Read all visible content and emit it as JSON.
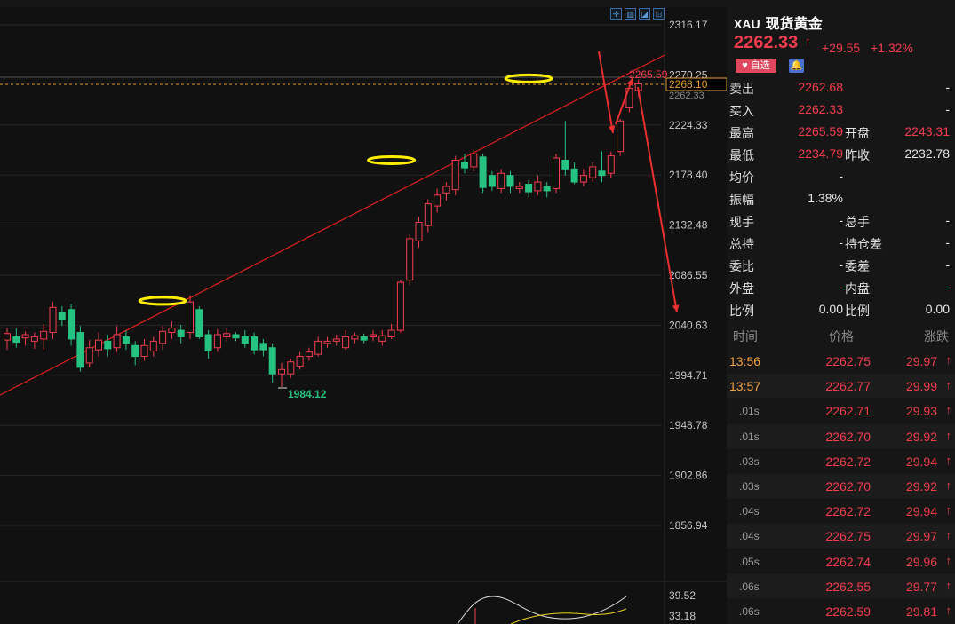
{
  "toolbar": {
    "icons": [
      "crosshair-icon",
      "candle-icon",
      "line-icon",
      "expand-icon"
    ]
  },
  "chart": {
    "price_ticks": [
      "2316.17",
      "2270.25",
      "2224.33",
      "2178.40",
      "2132.48",
      "2086.55",
      "2040.63",
      "1994.71",
      "1948.78",
      "1902.86",
      "1856.94"
    ],
    "indicator_ticks": [
      "39.52",
      "33.18"
    ],
    "high_label": "2265.59",
    "low_label": "1984.12",
    "cursor_price": "2268.10",
    "cursor_price_sub": "2262.33",
    "colors": {
      "up": "#f23d4f",
      "down": "#26c281",
      "trend_line": "#e0201e",
      "highlight": "#ffee00"
    }
  },
  "chart_data": {
    "type": "candlestick",
    "ylim": [
      1840,
      2330
    ],
    "candles": [
      [
        2027,
        2033,
        2018,
        2038
      ],
      [
        2030,
        2025,
        2020,
        2038
      ],
      [
        2029,
        2032,
        2022,
        2035
      ],
      [
        2026,
        2030,
        2019,
        2034
      ],
      [
        2028,
        2035,
        2018,
        2042
      ],
      [
        2034,
        2057,
        2028,
        2062
      ],
      [
        2052,
        2046,
        2040,
        2058
      ],
      [
        2055,
        2028,
        2022,
        2060
      ],
      [
        2034,
        2002,
        1998,
        2040
      ],
      [
        2006,
        2020,
        2002,
        2027
      ],
      [
        2018,
        2027,
        2012,
        2034
      ],
      [
        2026,
        2019,
        2012,
        2032
      ],
      [
        2020,
        2032,
        2016,
        2040
      ],
      [
        2030,
        2024,
        2018,
        2036
      ],
      [
        2022,
        2012,
        2004,
        2026
      ],
      [
        2012,
        2022,
        2008,
        2028
      ],
      [
        2017,
        2026,
        2012,
        2030
      ],
      [
        2024,
        2035,
        2018,
        2040
      ],
      [
        2034,
        2038,
        2028,
        2044
      ],
      [
        2036,
        2030,
        2024,
        2041
      ],
      [
        2034,
        2062,
        2028,
        2068
      ],
      [
        2055,
        2030,
        2028,
        2058
      ],
      [
        2032,
        2017,
        2010,
        2036
      ],
      [
        2020,
        2032,
        2016,
        2037
      ],
      [
        2030,
        2033,
        2026,
        2038
      ],
      [
        2032,
        2029,
        2026,
        2034
      ],
      [
        2030,
        2024,
        2020,
        2036
      ],
      [
        2030,
        2018,
        2014,
        2034
      ],
      [
        2024,
        2018,
        2012,
        2028
      ],
      [
        2020,
        1996,
        1988,
        2024
      ],
      [
        1996,
        2000,
        1984,
        2006
      ],
      [
        1996,
        2007,
        1992,
        2010
      ],
      [
        2003,
        2012,
        2000,
        2016
      ],
      [
        2012,
        2016,
        2008,
        2020
      ],
      [
        2014,
        2026,
        2012,
        2030
      ],
      [
        2024,
        2026,
        2020,
        2030
      ],
      [
        2026,
        2028,
        2022,
        2032
      ],
      [
        2020,
        2030,
        2018,
        2036
      ],
      [
        2028,
        2031,
        2024,
        2034
      ],
      [
        2030,
        2027,
        2024,
        2033
      ],
      [
        2030,
        2032,
        2026,
        2036
      ],
      [
        2026,
        2031,
        2022,
        2036
      ],
      [
        2030,
        2036,
        2028,
        2042
      ],
      [
        2036,
        2080,
        2034,
        2082
      ],
      [
        2082,
        2120,
        2078,
        2124
      ],
      [
        2118,
        2135,
        2112,
        2140
      ],
      [
        2132,
        2152,
        2126,
        2156
      ],
      [
        2150,
        2160,
        2144,
        2166
      ],
      [
        2162,
        2168,
        2155,
        2172
      ],
      [
        2165,
        2192,
        2160,
        2196
      ],
      [
        2190,
        2185,
        2180,
        2198
      ],
      [
        2186,
        2198,
        2182,
        2202
      ],
      [
        2195,
        2167,
        2162,
        2198
      ],
      [
        2178,
        2168,
        2164,
        2182
      ],
      [
        2166,
        2180,
        2162,
        2184
      ],
      [
        2178,
        2168,
        2162,
        2182
      ],
      [
        2166,
        2168,
        2162,
        2172
      ],
      [
        2170,
        2163,
        2158,
        2174
      ],
      [
        2164,
        2172,
        2160,
        2178
      ],
      [
        2168,
        2164,
        2158,
        2172
      ],
      [
        2166,
        2194,
        2162,
        2198
      ],
      [
        2192,
        2184,
        2178,
        2228
      ],
      [
        2184,
        2172,
        2170,
        2190
      ],
      [
        2172,
        2178,
        2168,
        2184
      ],
      [
        2176,
        2186,
        2172,
        2190
      ],
      [
        2182,
        2178,
        2172,
        2200
      ],
      [
        2180,
        2196,
        2176,
        2200
      ],
      [
        2200,
        2228,
        2196,
        2230
      ],
      [
        2240,
        2258,
        2236,
        2262
      ],
      [
        2256,
        2262,
        2250,
        2266
      ]
    ],
    "trend_line": [
      [
        0,
        1965
      ],
      [
        69,
        2299
      ]
    ],
    "highlights": [
      [
        17,
        2063
      ],
      [
        42,
        2192
      ],
      [
        57,
        2267
      ]
    ]
  },
  "quote": {
    "code": "XAU",
    "name": "现货黄金",
    "price": "2262.33",
    "arrow": "↑",
    "change": "+29.55",
    "change_pct": "+1.32%",
    "fav_label": "自选",
    "rows": [
      {
        "l1": "卖出",
        "v1": "2262.68",
        "c1": "red",
        "l2": "",
        "v2": "-",
        "c2": "white"
      },
      {
        "l1": "买入",
        "v1": "2262.33",
        "c1": "red",
        "l2": "",
        "v2": "-",
        "c2": "white"
      },
      {
        "l1": "最高",
        "v1": "2265.59",
        "c1": "red",
        "l2": "开盘",
        "v2": "2243.31",
        "c2": "red"
      },
      {
        "l1": "最低",
        "v1": "2234.79",
        "c1": "red",
        "l2": "昨收",
        "v2": "2232.78",
        "c2": "white"
      },
      {
        "l1": "均价",
        "v1": "-",
        "c1": "white",
        "l2": "",
        "v2": "",
        "c2": "white"
      },
      {
        "l1": "振幅",
        "v1": "1.38%",
        "c1": "white",
        "l2": "",
        "v2": "",
        "c2": "white"
      },
      {
        "l1": "现手",
        "v1": "-",
        "c1": "white",
        "l2": "总手",
        "v2": "-",
        "c2": "white"
      },
      {
        "l1": "总持",
        "v1": "-",
        "c1": "white",
        "l2": "持仓差",
        "v2": "-",
        "c2": "white"
      },
      {
        "l1": "委比",
        "v1": "-",
        "c1": "white",
        "l2": "委差",
        "v2": "-",
        "c2": "white"
      },
      {
        "l1": "外盘",
        "v1": "-",
        "c1": "red",
        "l2": "内盘",
        "v2": "-",
        "c2": "green"
      },
      {
        "l1": "比例",
        "v1": "0.00",
        "c1": "white",
        "l2": "比例",
        "v2": "0.00",
        "c2": "white"
      }
    ]
  },
  "ticks": {
    "headers": {
      "time": "时间",
      "price": "价格",
      "change": "涨跌"
    },
    "rows": [
      {
        "time": "13:56",
        "price": "2262.75",
        "change": "29.97",
        "arrow": "↑"
      },
      {
        "time": "13:57",
        "price": "2262.77",
        "change": "29.99",
        "arrow": "↑"
      },
      {
        "time": ".01s",
        "price": "2262.71",
        "change": "29.93",
        "arrow": "↑"
      },
      {
        "time": ".01s",
        "price": "2262.70",
        "change": "29.92",
        "arrow": "↑"
      },
      {
        "time": ".03s",
        "price": "2262.72",
        "change": "29.94",
        "arrow": "↑"
      },
      {
        "time": ".03s",
        "price": "2262.70",
        "change": "29.92",
        "arrow": "↑"
      },
      {
        "time": ".04s",
        "price": "2262.72",
        "change": "29.94",
        "arrow": "↑"
      },
      {
        "time": ".04s",
        "price": "2262.75",
        "change": "29.97",
        "arrow": "↑"
      },
      {
        "time": ".05s",
        "price": "2262.74",
        "change": "29.96",
        "arrow": "↑"
      },
      {
        "time": ".06s",
        "price": "2262.55",
        "change": "29.77",
        "arrow": "↑"
      },
      {
        "time": ".06s",
        "price": "2262.59",
        "change": "29.81",
        "arrow": "↑"
      }
    ]
  }
}
